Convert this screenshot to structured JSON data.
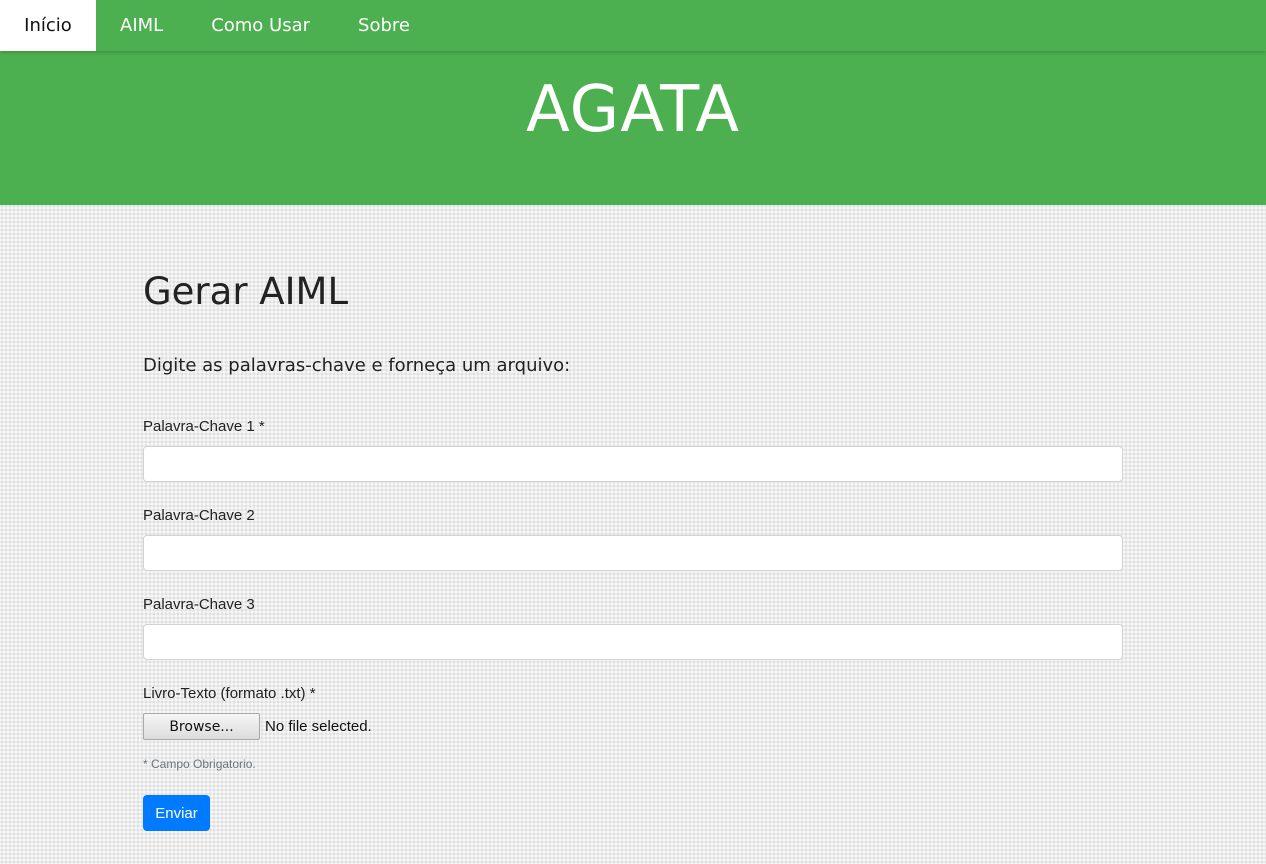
{
  "nav": {
    "items": [
      {
        "label": "Início",
        "active": true
      },
      {
        "label": "AIML",
        "active": false
      },
      {
        "label": "Como Usar",
        "active": false
      },
      {
        "label": "Sobre",
        "active": false
      }
    ]
  },
  "header": {
    "title": "AGATA"
  },
  "main": {
    "title": "Gerar AIML",
    "instructions": "Digite as palavras-chave e forneça um arquivo:",
    "fields": [
      {
        "label": "Palavra-Chave 1 *",
        "value": ""
      },
      {
        "label": "Palavra-Chave 2",
        "value": ""
      },
      {
        "label": "Palavra-Chave 3",
        "value": ""
      }
    ],
    "file": {
      "label": "Livro-Texto (formato .txt) *",
      "button_label": "Browse...",
      "status": "No file selected."
    },
    "required_note": "* Campo Obrigatorio.",
    "submit_label": "Enviar"
  },
  "colors": {
    "brand_green": "#4caf50",
    "primary_blue": "#007bff"
  }
}
